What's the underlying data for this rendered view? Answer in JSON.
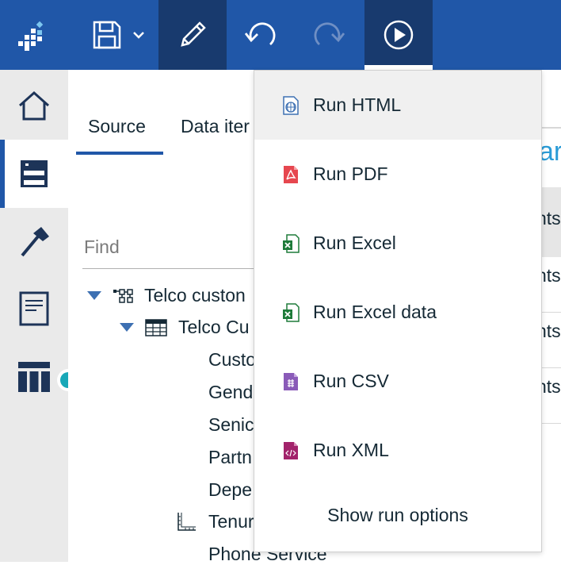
{
  "toolbar": {
    "save_menu_label": "",
    "colors": {
      "bar": "#2057a8",
      "active": "#183a6e"
    }
  },
  "left_rail": {
    "items": [
      {
        "icon": "home-icon"
      },
      {
        "icon": "data-source-icon"
      },
      {
        "icon": "hammer-icon"
      },
      {
        "icon": "report-page-icon"
      },
      {
        "icon": "table-icon"
      }
    ]
  },
  "source_panel": {
    "tabs": [
      {
        "label": "Source"
      },
      {
        "label": "Data iter"
      }
    ],
    "find_placeholder": "Find",
    "tree": [
      {
        "label": "Telco custon"
      },
      {
        "label": "Telco Cu"
      },
      {
        "label": "Custo"
      },
      {
        "label": "Gend"
      },
      {
        "label": "Senic"
      },
      {
        "label": "Partn"
      },
      {
        "label": "Depe"
      },
      {
        "label": "Tenur"
      },
      {
        "label": "Phone Service"
      }
    ]
  },
  "background": {
    "heading_fragment": "ar",
    "cells": [
      "nts",
      "nts",
      "nts",
      "nts"
    ]
  },
  "run_menu": {
    "items": [
      {
        "label": "Run HTML",
        "icon": "html-globe-icon",
        "color": "#3d70b2"
      },
      {
        "label": "Run PDF",
        "icon": "pdf-icon",
        "color": "#e6474f"
      },
      {
        "label": "Run Excel",
        "icon": "excel-icon",
        "color": "#1e7b3a"
      },
      {
        "label": "Run Excel data",
        "icon": "excel-data-icon",
        "color": "#1e7b3a"
      },
      {
        "label": "Run CSV",
        "icon": "csv-icon",
        "color": "#8a5bb8"
      },
      {
        "label": "Run XML",
        "icon": "xml-icon",
        "color": "#a2236b"
      }
    ],
    "show_options_label": "Show run options"
  }
}
